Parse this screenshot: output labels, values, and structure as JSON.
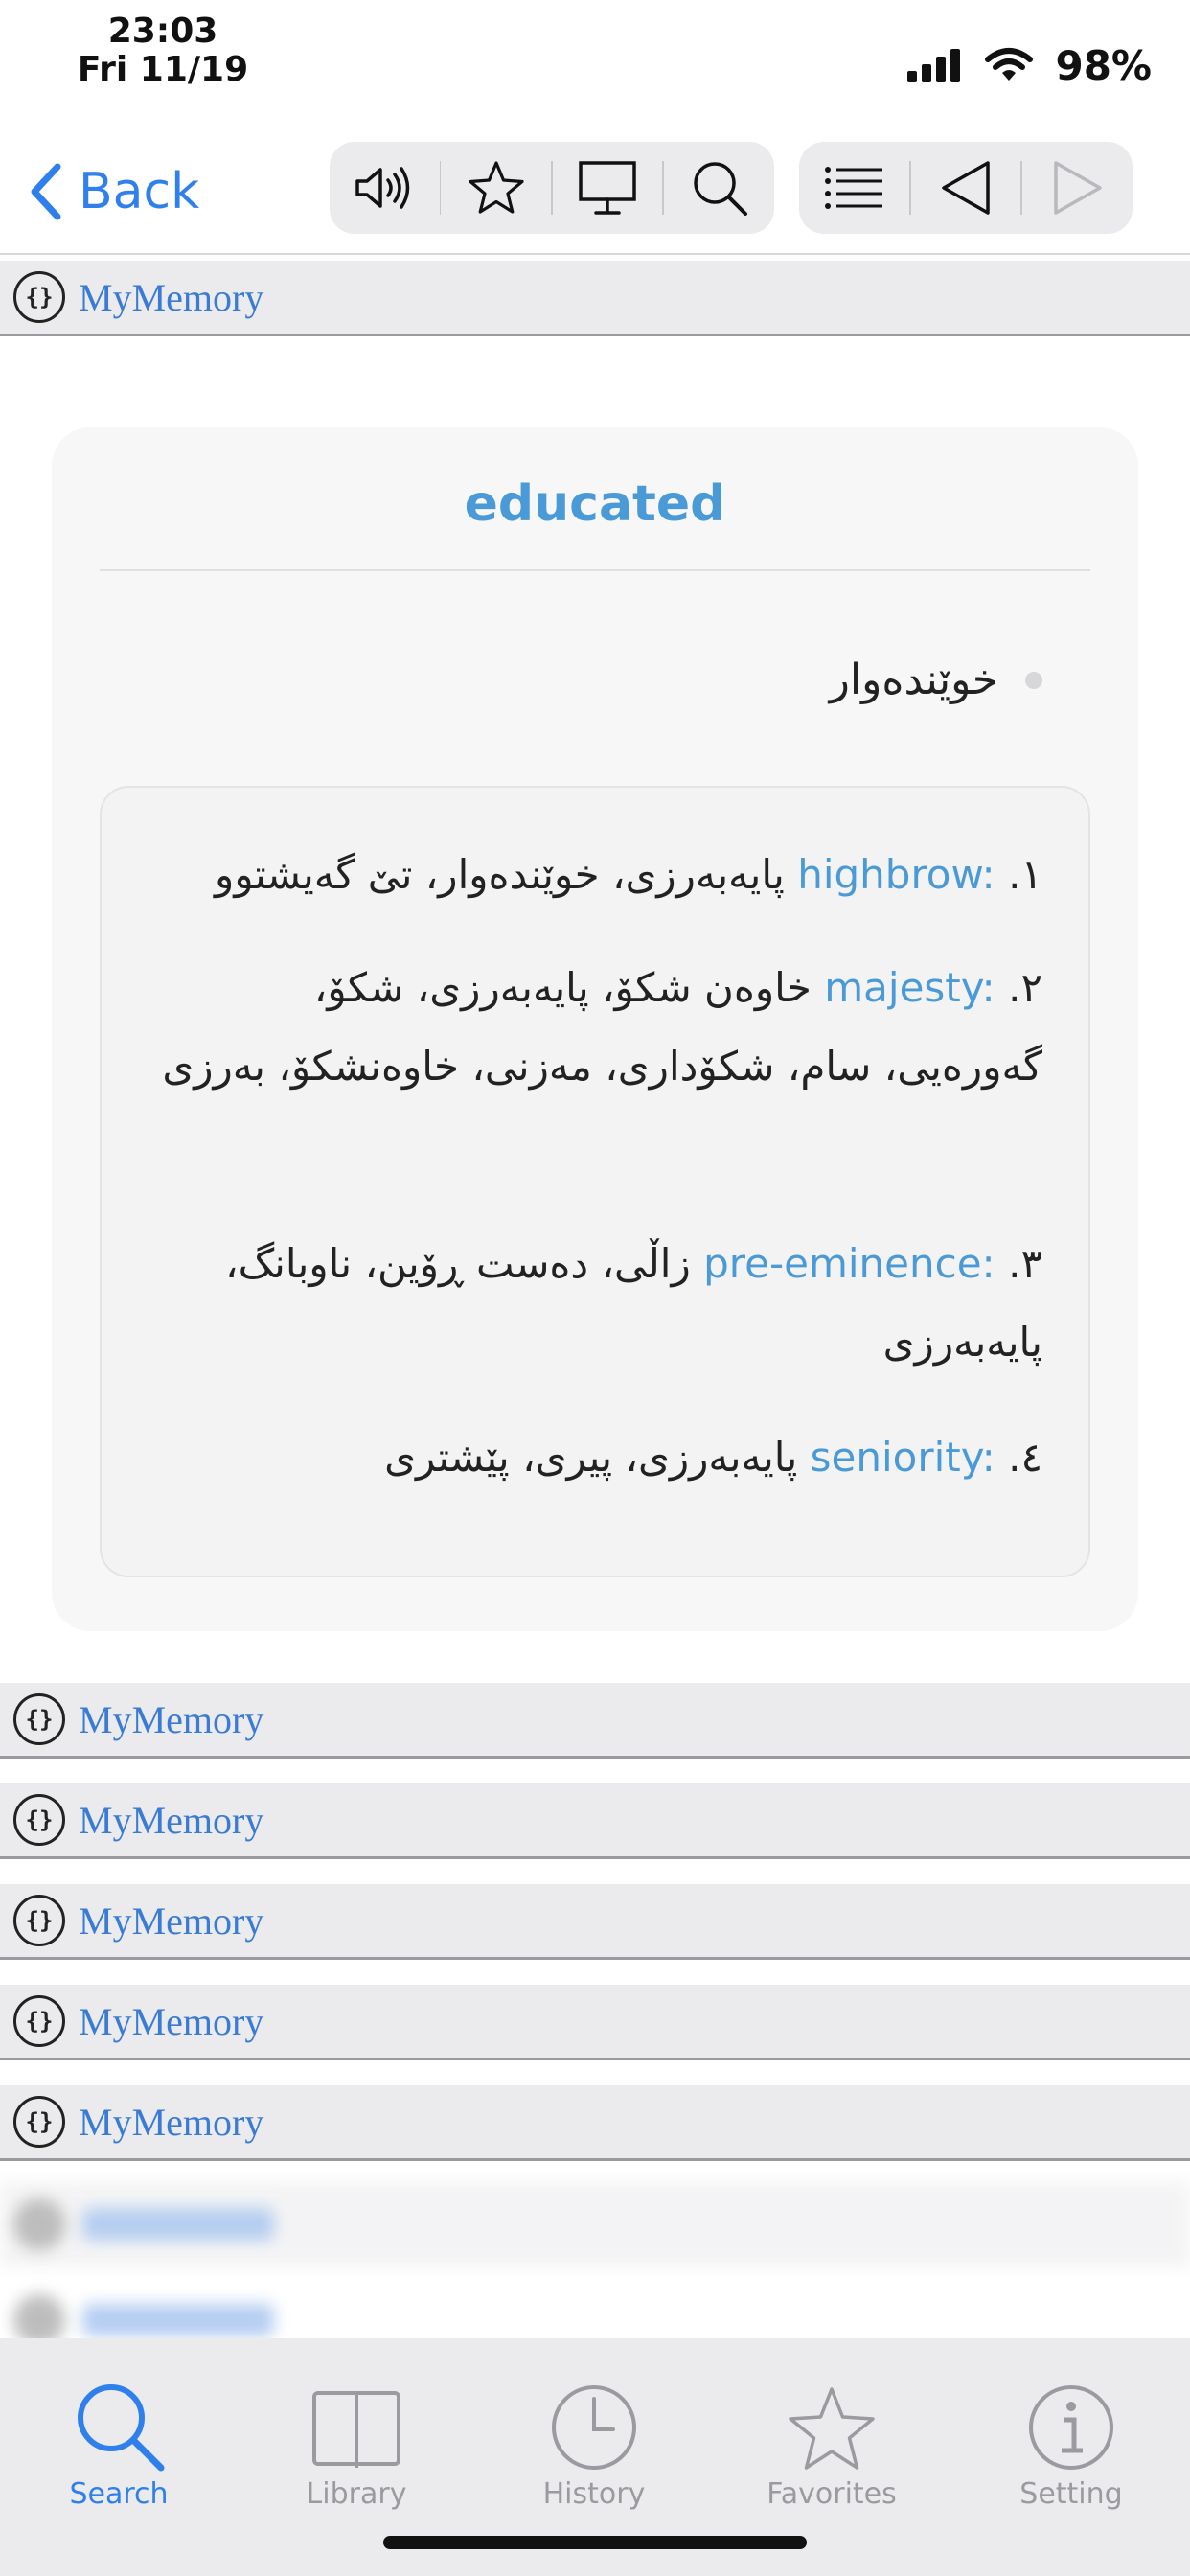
{
  "status_bar": {
    "time": "23:03",
    "date": "Fri 11/19",
    "battery": "98%"
  },
  "nav": {
    "back_label": "Back",
    "tools": [
      "speaker-icon",
      "star-icon",
      "monitor-icon",
      "search-icon"
    ],
    "nav_tools": [
      "list-icon",
      "previous-icon",
      "next-icon"
    ]
  },
  "sources": {
    "badge": "{}",
    "label": "MyMemory"
  },
  "card": {
    "headword": "educated",
    "translation": "خوێندەوار",
    "entries": [
      {
        "num": "١.",
        "term": "highbrow:",
        "text": "پایەبەرزی، خوێندەوار، تێ گەیشتوو"
      },
      {
        "num": "٢.",
        "term": "majesty:",
        "text": "خاوەن شکۆ، پایەبەرزی، شکۆ، گەورەیی، سام، شکۆداری، مەزنی، خاوەنشکۆ، بەرزی"
      },
      {
        "num": "٣.",
        "term": "pre-eminence:",
        "text": "زاڵی، دەست ڕۆین، ناوبانگ، پایەبەرزی"
      },
      {
        "num": "٤.",
        "term": "seniority:",
        "text": "پایەبەرزی، پیری، پێشتری"
      }
    ]
  },
  "more_sources": [
    "MyMemory",
    "MyMemory",
    "MyMemory",
    "MyMemory",
    "MyMemory"
  ],
  "tabs": [
    {
      "label": "Search",
      "icon": "search-icon",
      "active": true
    },
    {
      "label": "Library",
      "icon": "book-icon",
      "active": false
    },
    {
      "label": "History",
      "icon": "clock-icon",
      "active": false
    },
    {
      "label": "Favorites",
      "icon": "star-icon",
      "active": false
    },
    {
      "label": "Setting",
      "icon": "info-icon",
      "active": false
    }
  ],
  "colors": {
    "accent": "#2f80ed",
    "term": "#4a9ad8",
    "row_bg": "#ebebed"
  }
}
